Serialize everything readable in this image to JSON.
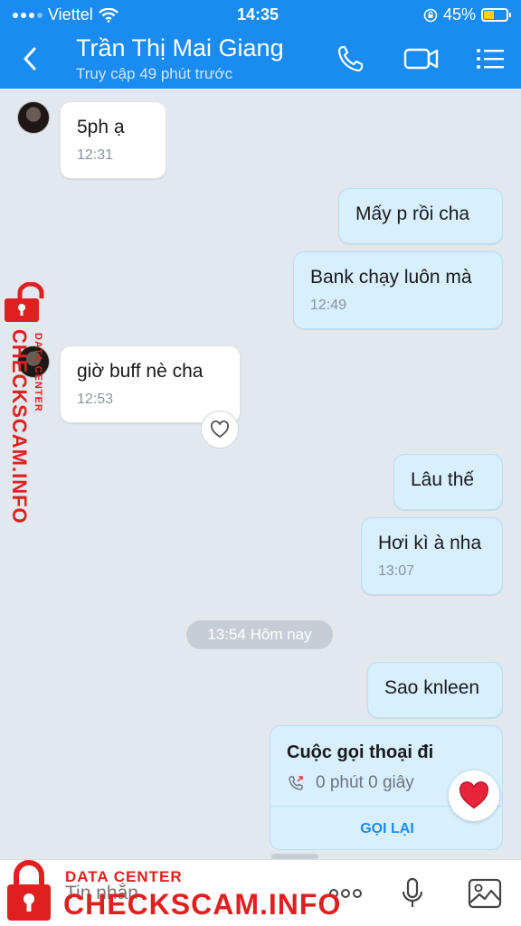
{
  "status_bar": {
    "carrier": "Viettel",
    "time": "14:35",
    "battery_text": "45%",
    "battery_level": 0.45
  },
  "header": {
    "contact_name": "Trần Thị Mai Giang",
    "last_seen": "Truy cập 49 phút trước"
  },
  "messages": [
    {
      "dir": "in",
      "text": "5ph ạ",
      "time": "12:31"
    },
    {
      "dir": "out",
      "text": "Mấy p rồi cha",
      "time": ""
    },
    {
      "dir": "out",
      "text": "Bank chạy luôn mà",
      "time": "12:49"
    },
    {
      "dir": "in",
      "text": "giờ  buff nè cha",
      "time": "12:53"
    },
    {
      "dir": "out",
      "text": "Lâu thế",
      "time": ""
    },
    {
      "dir": "out",
      "text": "Hơi kì à nha",
      "time": "13:07"
    },
    {
      "dir": "out",
      "text": "Sao knleen",
      "time": ""
    }
  ],
  "date_separator": "13:54 Hôm nay",
  "call_card": {
    "title": "Cuộc gọi thoại đi",
    "detail": "0 phút 0 giây",
    "action": "GỌI LẠI"
  },
  "input": {
    "placeholder": "Tin nhắn"
  },
  "watermark": {
    "label_small": "DATA CENTER",
    "label_big": "CHECKSCAM.INFO"
  },
  "colors": {
    "brand_blue": "#1a8cf1",
    "outgoing_bubble": "#d7efff",
    "watermark_red": "#e02020"
  },
  "icons": [
    "wifi-icon",
    "lock-rotation-icon",
    "battery-icon",
    "back-icon",
    "phone-icon",
    "video-icon",
    "menu-icon",
    "heart-icon",
    "outgoing-call-icon",
    "more-icon",
    "mic-icon",
    "image-icon"
  ]
}
